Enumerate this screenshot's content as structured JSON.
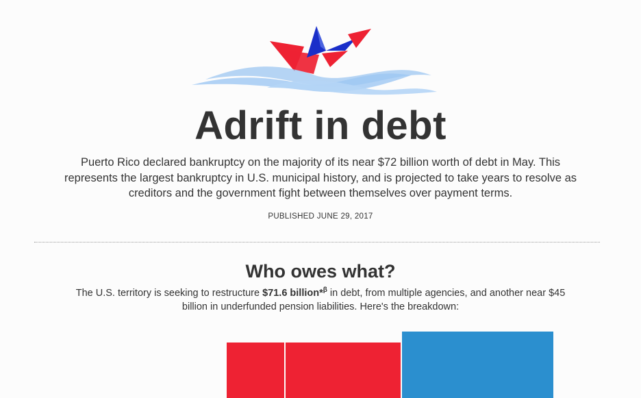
{
  "header": {
    "title": "Adrift in debt",
    "dek": "Puerto Rico declared bankruptcy on the majority of its near $72 billion worth of debt in May. This represents the largest bankruptcy in U.S. municipal history, and is projected to take years to resolve as creditors and the government fight between themselves over payment terms.",
    "published": "PUBLISHED JUNE 29, 2017"
  },
  "section": {
    "heading": "Who owes what?",
    "desc_before": "The U.S. territory is seeking to restructure ",
    "desc_bold": "$71.6 billion*",
    "desc_sup": "β",
    "desc_after": " in debt, from multiple agencies, and another near $45 billion in underfunded pension liabilities. Here's the breakdown:"
  },
  "colors": {
    "red": "#ee2233",
    "blue": "#2b8fcf",
    "navy": "#1a2fc9",
    "wave": "#9ec7f2"
  },
  "icons": [
    "paper-boat-logo-icon",
    "waves-icon"
  ]
}
